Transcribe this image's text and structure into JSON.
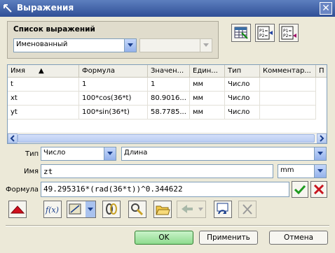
{
  "window": {
    "title": "Выражения",
    "accent": "#2F4F96"
  },
  "list_group": {
    "label": "Список выражений",
    "filter_value": "Именованный",
    "secondary_value": ""
  },
  "toolbar_top": {
    "icons": [
      "spreadsheet-icon",
      "export-p1p2-icon",
      "import-p1p2-icon"
    ]
  },
  "table": {
    "columns": [
      "Имя",
      "Формула",
      "Значен...",
      "Един...",
      "Тип",
      "Комментар...",
      "П"
    ],
    "rows": [
      {
        "name": "t",
        "formula": "1",
        "value": "1",
        "unit": "мм",
        "type": "Число",
        "comment": ""
      },
      {
        "name": "xt",
        "formula": "100*cos(36*t)",
        "value": "80.9016...",
        "unit": "мм",
        "type": "Число",
        "comment": ""
      },
      {
        "name": "yt",
        "formula": "100*sin(36*t)",
        "value": "58.7785...",
        "unit": "мм",
        "type": "Число",
        "comment": ""
      }
    ],
    "sort_indicator": "▲"
  },
  "form": {
    "type_label": "Тип",
    "type_value": "Число",
    "dimension_value": "Длина",
    "name_label": "Имя",
    "name_value": "zt",
    "unit_value": "mm",
    "formula_label": "Формула",
    "formula_value": "49.295316*(rad(36*t))^0.344622"
  },
  "action_icons": [
    "collapse-up-icon",
    "function-icon",
    "measure-icon",
    "link-chain-icon",
    "find-icon",
    "open-folder-icon",
    "replace-icon",
    "refresh-icon",
    "delete-icon"
  ],
  "buttons": {
    "ok": "OK",
    "apply": "Применить",
    "cancel": "Отмена"
  }
}
